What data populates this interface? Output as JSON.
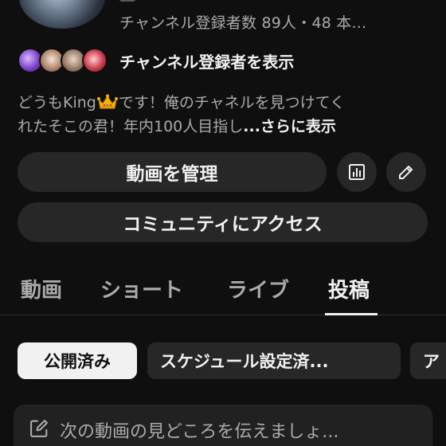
{
  "channel": {
    "stats_text": "チャンネル登録者数 89人・48 本...",
    "subscribers_label": "チャンネル登録者を表示",
    "description_line1_a": "どうもKing",
    "description_line1_b": "です！俺のチャネルを見つけてく",
    "description_line2": "れたそこの君！年内100人目指し",
    "description_fade": "",
    "more_label": "...さらに表示"
  },
  "actions": {
    "manage_videos": "動画を管理",
    "community_access": "コミュニティにアクセス",
    "analytics_icon": "analytics-icon",
    "edit_icon": "pencil-icon"
  },
  "tabs": [
    {
      "label": "動画",
      "active": false
    },
    {
      "label": "ショート",
      "active": false
    },
    {
      "label": "ライブ",
      "active": false
    },
    {
      "label": "投稿",
      "active": true
    }
  ],
  "filter_chips": [
    {
      "label": "公開済み",
      "selected": true
    },
    {
      "label": "スケジュール設定済...",
      "selected": false
    },
    {
      "label": "ア",
      "selected": false
    }
  ],
  "compose": {
    "placeholder": "次の動画の見どころを伝えましょ..."
  },
  "colors": {
    "background": "#0f0f0f",
    "surface": "#272727",
    "text_primary": "#f1f1f1",
    "text_secondary": "#aaaaaa"
  }
}
